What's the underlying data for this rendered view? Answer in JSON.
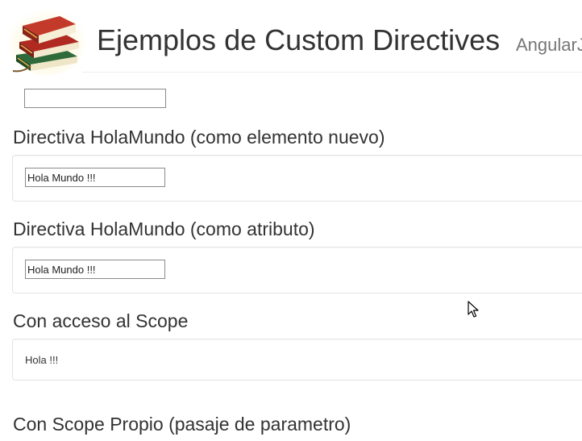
{
  "header": {
    "title": "Ejemplos de Custom Directives",
    "subtitle": "AngularJS",
    "logo_icon": "books-stack-icon"
  },
  "top_input": {
    "value": ""
  },
  "sections": [
    {
      "title": "Directiva HolaMundo (como elemento nuevo)",
      "input_value": "Hola Mundo !!!"
    },
    {
      "title": "Directiva HolaMundo (como atributo)",
      "input_value": "Hola Mundo !!!"
    },
    {
      "title": "Con acceso al Scope",
      "text": "Hola !!!"
    },
    {
      "title": "Con Scope Propio (pasaje de parametro)"
    }
  ],
  "cursor_icon": "mouse-pointer-icon"
}
